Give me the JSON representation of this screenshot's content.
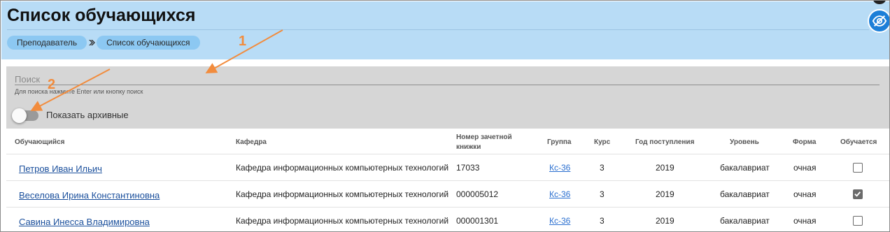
{
  "header": {
    "title": "Список обучающихся",
    "breadcrumb": [
      "Преподаватель",
      "Список обучающихся"
    ]
  },
  "filters": {
    "search_placeholder": "Поиск",
    "search_hint": "Для поиска нажмите Enter или кнопку поиск",
    "toggle_label": "Показать архивные",
    "toggle_on": false
  },
  "table": {
    "columns": {
      "student": "Обучающийся",
      "department": "Кафедра",
      "record_line1": "Номер зачетной",
      "record_line2": "книжки",
      "group": "Группа",
      "course": "Курс",
      "year": "Год поступления",
      "level": "Уровень",
      "form": "Форма",
      "studying": "Обучается"
    },
    "rows": [
      {
        "name": "Петров Иван Ильич",
        "department": "Кафедра информационных компьютерных технологий",
        "record": "17033",
        "group": "Кс-36",
        "course": "3",
        "year": "2019",
        "level": "бакалавриат",
        "form": "очная",
        "studying": false
      },
      {
        "name": "Веселова Ирина Константиновна",
        "department": "Кафедра информационных компьютерных технологий",
        "record": "000005012",
        "group": "Кс-36",
        "course": "3",
        "year": "2019",
        "level": "бакалавриат",
        "form": "очная",
        "studying": true
      },
      {
        "name": "Савина Инесса Владимировна",
        "department": "Кафедра информационных компьютерных технологий",
        "record": "000001301",
        "group": "Кс-36",
        "course": "3",
        "year": "2019",
        "level": "бакалавриат",
        "form": "очная",
        "studying": false
      }
    ]
  },
  "annotations": {
    "label_1": "1",
    "label_2": "2",
    "arrow_color": "#f28c3d"
  },
  "icons": {
    "visibility": "eye-off-icon",
    "breadcrumb_separator": "double-chevron-right-icon"
  },
  "colors": {
    "header_bg": "#b8dcf6",
    "crumb_bg": "#8cc8f2",
    "filter_bg": "#d6d6d6",
    "link": "#1a4f9c",
    "accent_button": "#1c7fd8"
  }
}
